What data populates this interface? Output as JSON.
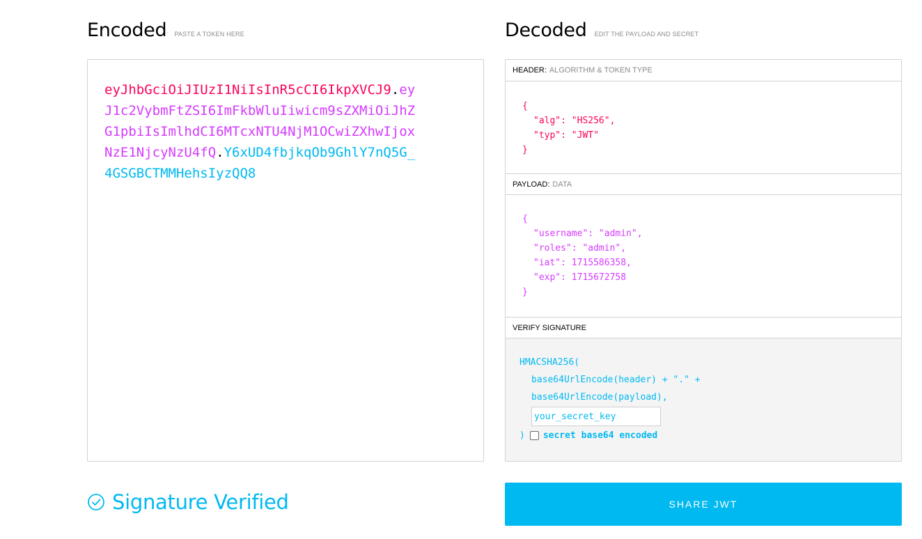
{
  "encoded": {
    "title": "Encoded",
    "hint": "PASTE A TOKEN HERE",
    "lines": [
      {
        "header": "eyJhbGciOiJIUzI1NiIsInR5cCI6IkpXVCJ9",
        "dot1": ".",
        "payload": "ey"
      },
      {
        "payload": "J1c2VybmFtZSI6ImFkbWluIiwicm9sZXMiOiJhZ"
      },
      {
        "payload": "G1pbiIsImlhdCI6MTcxNTU4NjM1OCwiZXhwIjox"
      },
      {
        "payload": "NzE1NjcyNzU4fQ",
        "dot2": ".",
        "signature": "Y6xUD4fbjkqOb9GhlY7nQ5G_"
      },
      {
        "signature": "4GSGBCTMMHehsIyzQQ8"
      }
    ]
  },
  "decoded": {
    "title": "Decoded",
    "hint": "EDIT THE PAYLOAD AND SECRET",
    "header_section": {
      "label": "HEADER:",
      "sublabel": "ALGORITHM & TOKEN TYPE",
      "open": "{",
      "lines": [
        "\"alg\": \"HS256\",",
        "\"typ\": \"JWT\""
      ],
      "close": "}"
    },
    "payload_section": {
      "label": "PAYLOAD:",
      "sublabel": "DATA",
      "open": "{",
      "lines": [
        "\"username\": \"admin\",",
        "\"roles\": \"admin\",",
        "\"iat\": 1715586358,",
        "\"exp\": 1715672758"
      ],
      "close": "}"
    },
    "verify_section": {
      "label": "VERIFY SIGNATURE",
      "fn_open": "HMACSHA256(",
      "line1": "base64UrlEncode(header) + \".\" +",
      "line2": "base64UrlEncode(payload),",
      "secret_placeholder": "your_secret_key",
      "secret_value": "",
      "fn_close": ")",
      "checkbox_label": "secret base64 encoded",
      "checkbox_checked": false
    }
  },
  "status": {
    "text": "Signature Verified",
    "icon": "check-circle-icon"
  },
  "share_button": {
    "label": "SHARE JWT"
  },
  "colors": {
    "header": "#fb015b",
    "payload": "#d63aff",
    "signature": "#00b9f1",
    "accent": "#00b9f1"
  }
}
